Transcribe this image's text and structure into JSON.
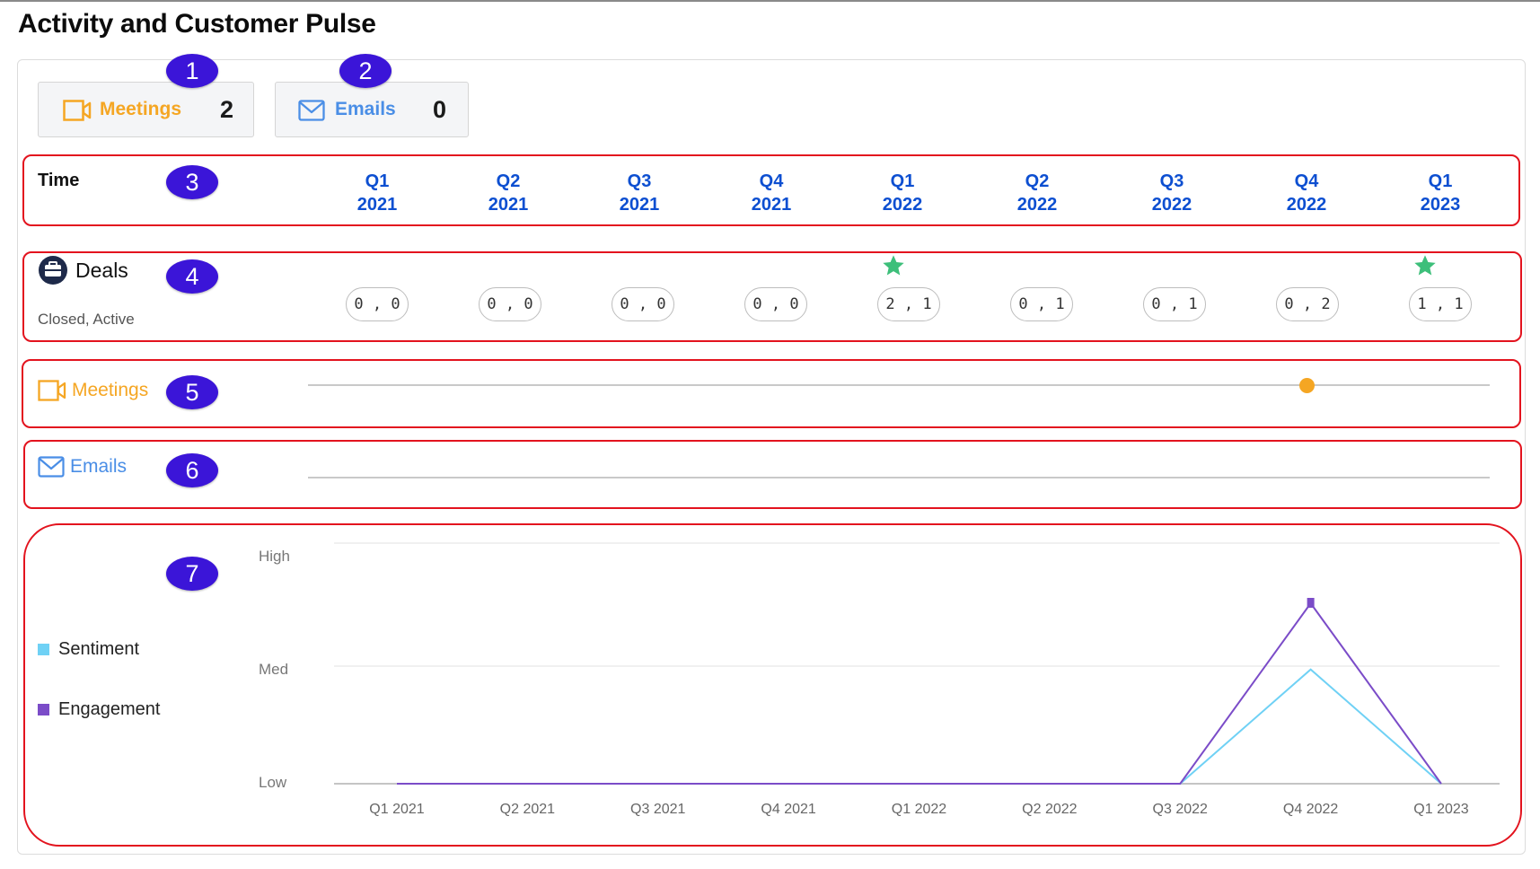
{
  "page": {
    "title": "Activity and Customer Pulse"
  },
  "summary": {
    "meetings": {
      "label": "Meetings",
      "count": "2",
      "icon": "video-camera-icon",
      "color": "#f5a623"
    },
    "emails": {
      "label": "Emails",
      "count": "0",
      "icon": "envelope-icon",
      "color": "#4a8ee6"
    }
  },
  "markers": [
    "1",
    "2",
    "3",
    "4",
    "5",
    "6",
    "7"
  ],
  "timeline": {
    "title": "Time",
    "quarters": [
      {
        "q": "Q1",
        "y": "2021"
      },
      {
        "q": "Q2",
        "y": "2021"
      },
      {
        "q": "Q3",
        "y": "2021"
      },
      {
        "q": "Q4",
        "y": "2021"
      },
      {
        "q": "Q1",
        "y": "2022"
      },
      {
        "q": "Q2",
        "y": "2022"
      },
      {
        "q": "Q3",
        "y": "2022"
      },
      {
        "q": "Q4",
        "y": "2022"
      },
      {
        "q": "Q1",
        "y": "2023"
      }
    ]
  },
  "deals": {
    "label": "Deals",
    "sublabel": "Closed, Active",
    "icon": "briefcase-icon",
    "values": [
      "0 , 0",
      "0 , 0",
      "0 , 0",
      "0 , 0",
      "2 , 1",
      "0 , 1",
      "0 , 1",
      "0 , 2",
      "1 , 1"
    ],
    "star_quarters": [
      4,
      8
    ],
    "star_color": "#3dbf7a"
  },
  "meetings_row": {
    "label": "Meetings",
    "icon": "video-camera-icon",
    "color": "#f5a623",
    "events_quarter_index": [
      7.0
    ]
  },
  "emails_row": {
    "label": "Emails",
    "icon": "envelope-icon",
    "color": "#4a8ee6",
    "events_quarter_index": []
  },
  "chart_data": {
    "type": "line",
    "categories": [
      "Q1 2021",
      "Q2 2021",
      "Q3 2021",
      "Q4 2021",
      "Q1 2022",
      "Q2 2022",
      "Q3 2022",
      "Q4 2022",
      "Q1 2023"
    ],
    "y_ticks": [
      "Low",
      "Med",
      "High"
    ],
    "ylim": [
      0,
      2
    ],
    "grid": true,
    "legend_position": "left",
    "series": [
      {
        "name": "Sentiment",
        "color": "#6fd1f5",
        "values": [
          0,
          0,
          0,
          0,
          0,
          0,
          0,
          0.95,
          0
        ]
      },
      {
        "name": "Engagement",
        "color": "#7b4cc8",
        "values": [
          0,
          0,
          0,
          0,
          0,
          0,
          0,
          1.5,
          0
        ]
      }
    ]
  }
}
